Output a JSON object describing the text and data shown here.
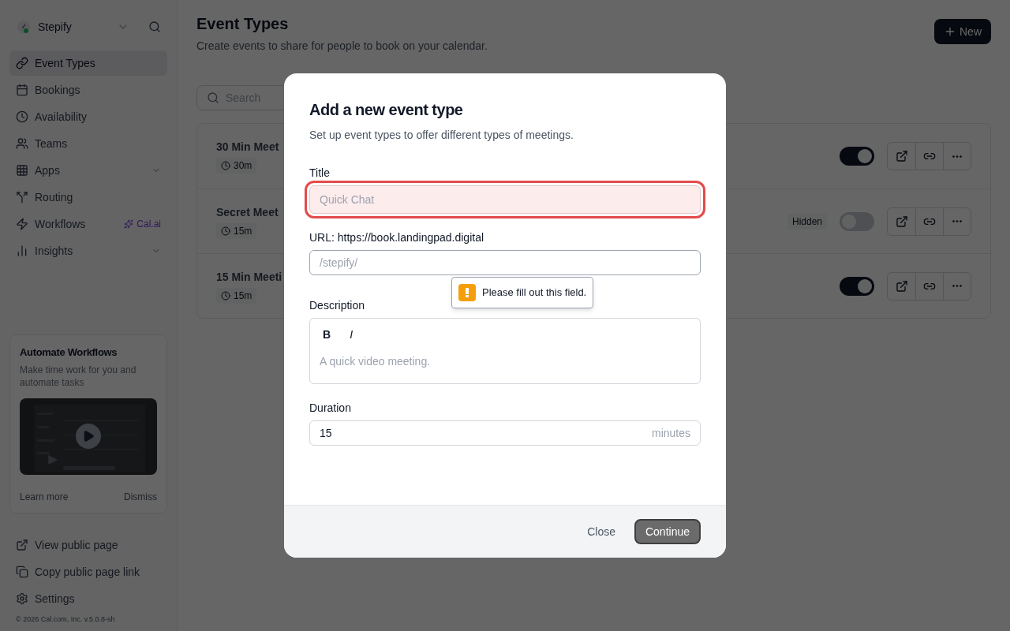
{
  "sidebar": {
    "brand": "Stepify",
    "nav": [
      {
        "label": "Event Types",
        "selected": true,
        "has_submenu": false
      },
      {
        "label": "Bookings",
        "selected": false,
        "has_submenu": false
      },
      {
        "label": "Availability",
        "selected": false,
        "has_submenu": false
      },
      {
        "label": "Teams",
        "selected": false,
        "has_submenu": false
      },
      {
        "label": "Apps",
        "selected": false,
        "has_submenu": true
      },
      {
        "label": "Routing",
        "selected": false,
        "has_submenu": false
      },
      {
        "label": "Workflows",
        "selected": false,
        "has_submenu": false,
        "badge": "Cal.ai"
      },
      {
        "label": "Insights",
        "selected": false,
        "has_submenu": true
      }
    ],
    "promo": {
      "title": "Automate Workflows",
      "text": "Make time work for you and automate tasks",
      "learn_more": "Learn more",
      "dismiss": "Dismiss"
    },
    "footer": [
      {
        "label": "View public page"
      },
      {
        "label": "Copy public page link"
      },
      {
        "label": "Settings"
      }
    ],
    "copyright": "© 2026 Cal.com, Inc. v.5.0.8-sh"
  },
  "header": {
    "title": "Event Types",
    "subtitle": "Create events to share for people to book on your calendar.",
    "new_button": "New"
  },
  "search": {
    "placeholder": "Search"
  },
  "events": [
    {
      "title": "30 Min Meet",
      "duration": "30m",
      "enabled": true
    },
    {
      "title": "Secret Meet",
      "duration": "15m",
      "enabled": false,
      "badge": "Hidden"
    },
    {
      "title": "15 Min Meeti",
      "duration": "15m",
      "enabled": true
    }
  ],
  "dialog": {
    "title": "Add a new event type",
    "subtitle": "Set up event types to offer different types of meetings.",
    "title_field": {
      "label": "Title",
      "placeholder": "Quick Chat",
      "invalid": true
    },
    "url_field": {
      "label": "URL: https://book.landingpad.digital",
      "placeholder": "/stepify/"
    },
    "validation": "Please fill out this field.",
    "description": {
      "label": "Description",
      "bold": "B",
      "italic": "I",
      "placeholder": "A quick video meeting."
    },
    "duration": {
      "label": "Duration",
      "value": "15",
      "suffix": "minutes"
    },
    "buttons": {
      "close": "Close",
      "continue": "Continue"
    }
  }
}
